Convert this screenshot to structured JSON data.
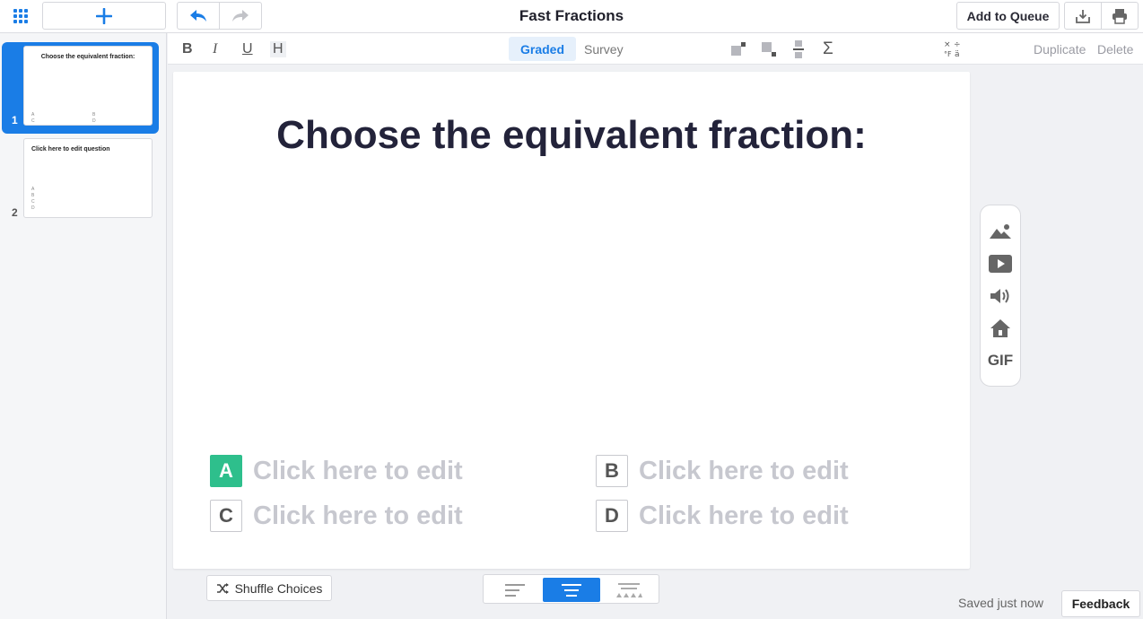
{
  "header": {
    "title": "Fast Fractions",
    "add_to_queue_label": "Add to Queue",
    "icons": {
      "grid": "grid-icon",
      "add": "plus-icon",
      "undo": "undo-icon",
      "redo": "redo-icon",
      "download": "download-icon",
      "print": "print-icon"
    }
  },
  "sidebar": {
    "slides": [
      {
        "number": "1",
        "title": "Choose the equivalent fraction:",
        "active": true
      },
      {
        "number": "2",
        "title": "Click here to edit question",
        "active": false
      }
    ]
  },
  "toolbar": {
    "bold": "B",
    "italic": "I",
    "underline": "U",
    "heading": "H",
    "modes": [
      "Graded",
      "Survey"
    ],
    "active_mode": "Graded",
    "sigma": "Σ",
    "duplicate_label": "Duplicate",
    "delete_label": "Delete"
  },
  "canvas": {
    "question": "Choose the equivalent fraction:",
    "choices": [
      {
        "letter": "A",
        "text": "Click here to edit",
        "correct": true
      },
      {
        "letter": "B",
        "text": "Click here to edit",
        "correct": false
      },
      {
        "letter": "C",
        "text": "Click here to edit",
        "correct": false
      },
      {
        "letter": "D",
        "text": "Click here to edit",
        "correct": false
      }
    ]
  },
  "media_panel": {
    "items": [
      "image-icon",
      "video-icon",
      "audio-icon",
      "house-icon",
      "gif-icon"
    ],
    "gif_label": "GIF"
  },
  "footer": {
    "shuffle_label": "Shuffle Choices",
    "align_active": "center",
    "saved_status": "Saved just now",
    "feedback_label": "Feedback"
  },
  "colors": {
    "accent": "#1a7de6",
    "correct": "#2ebf8c",
    "placeholder": "#c7c8cf"
  }
}
